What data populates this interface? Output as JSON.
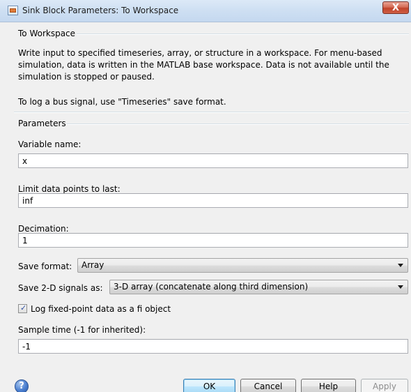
{
  "window": {
    "title": "Sink Block Parameters: To Workspace",
    "close_glyph": "X"
  },
  "block_group": {
    "title": "To Workspace",
    "description": "Write input to specified timeseries, array, or structure in a workspace. For menu-based simulation, data is written in the MATLAB base workspace. Data is not available until the simulation is stopped or paused.",
    "bus_note": "To log a bus signal, use \"Timeseries\" save format."
  },
  "parameters": {
    "title": "Parameters",
    "variable_name": {
      "label": "Variable name:",
      "value": "x"
    },
    "limit_points": {
      "label": "Limit data points to last:",
      "value": "inf"
    },
    "decimation": {
      "label": "Decimation:",
      "value": "1"
    },
    "save_format": {
      "label": "Save format:",
      "selected": "Array"
    },
    "save_2d": {
      "label": "Save 2-D signals as:",
      "selected": "3-D array (concatenate along third dimension)"
    },
    "log_fixed_point": {
      "label": "Log fixed-point data as a fi object",
      "checked": true
    },
    "sample_time": {
      "label": "Sample time (-1 for inherited):",
      "value": "-1"
    }
  },
  "buttons": {
    "help_icon_glyph": "?",
    "ok": "OK",
    "cancel": "Cancel",
    "help": "Help",
    "apply": "Apply"
  },
  "icons": {
    "window_icon": "simulink-block-icon",
    "close": "close-icon",
    "help": "help-circle-icon",
    "dropdown": "chevron-down-icon",
    "checkbox": "checkmark-icon"
  }
}
